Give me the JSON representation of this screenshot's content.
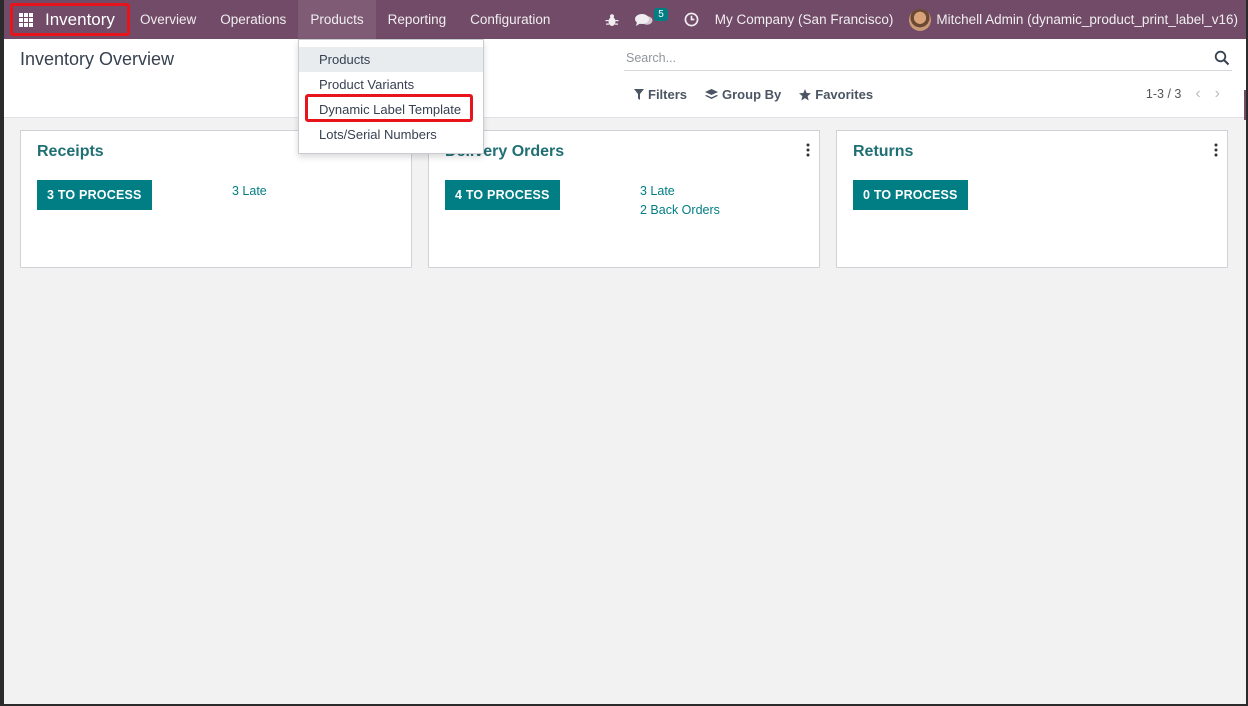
{
  "navbar": {
    "app_name": "Inventory",
    "menu": [
      {
        "label": "Overview"
      },
      {
        "label": "Operations"
      },
      {
        "label": "Products"
      },
      {
        "label": "Reporting"
      },
      {
        "label": "Configuration"
      }
    ],
    "messages_badge": "5",
    "company": "My Company (San Francisco)",
    "user": "Mitchell Admin (dynamic_product_print_label_v16)",
    "colors": {
      "bar": "#714b67",
      "highlight": "#e8141c"
    }
  },
  "products_dropdown": {
    "items": [
      {
        "label": "Products"
      },
      {
        "label": "Product Variants"
      },
      {
        "label": "Dynamic Label Template"
      },
      {
        "label": "Lots/Serial Numbers"
      }
    ]
  },
  "control_panel": {
    "title": "Inventory Overview",
    "search_placeholder": "Search...",
    "filters_label": "Filters",
    "group_by_label": "Group By",
    "favorites_label": "Favorites",
    "pager": "1-3 / 3"
  },
  "cards": [
    {
      "title": "Receipts",
      "button": "3 TO PROCESS",
      "links": [
        "3 Late"
      ]
    },
    {
      "title": "Delivery Orders",
      "button": "4 TO PROCESS",
      "links": [
        "3 Late",
        "2 Back Orders"
      ]
    },
    {
      "title": "Returns",
      "button": "0 TO PROCESS",
      "links": []
    }
  ],
  "accent_color": "#017e84"
}
